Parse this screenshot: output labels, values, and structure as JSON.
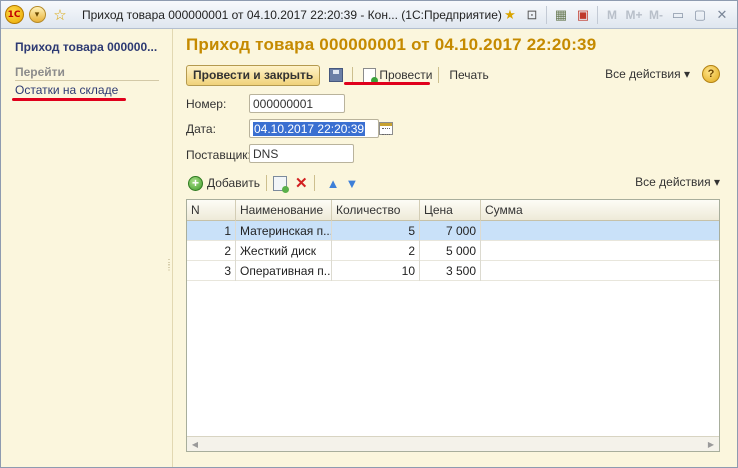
{
  "window": {
    "title": "Приход товара 000000001 от 04.10.2017 22:20:39 - Кон...  (1С:Предприятие)"
  },
  "titlebar_icons": {
    "logo": "1c",
    "menu": "chevron-down-icon",
    "favorite": "star-icon",
    "right": [
      "favorite-add-icon",
      "history-icon",
      "calculator-icon",
      "calendar-icon"
    ],
    "memory": [
      "M",
      "M+",
      "M-"
    ],
    "window_buttons": [
      "minimize-icon",
      "maximize-icon",
      "close-icon"
    ]
  },
  "sidebar": {
    "title": "Приход товара 000000...",
    "section": "Перейти",
    "items": [
      {
        "label": "Остатки на складе"
      }
    ]
  },
  "form": {
    "title": "Приход товара 000000001 от 04.10.2017 22:20:39",
    "toolbar": {
      "post_and_close": "Провести и закрыть",
      "post": "Провести",
      "print": "Печать",
      "all_actions": "Все действия",
      "help": "?"
    },
    "fields": {
      "number_label": "Номер:",
      "number_value": "000000001",
      "date_label": "Дата:",
      "date_value": "04.10.2017 22:20:39",
      "supplier_label": "Поставщик:",
      "supplier_value": "DNS"
    },
    "table_toolbar": {
      "add": "Добавить",
      "all_actions": "Все действия"
    },
    "table": {
      "columns": [
        "N",
        "Наименование",
        "Количество",
        "Цена",
        "Сумма"
      ],
      "rows": [
        {
          "n": "1",
          "name": "Материнская п...",
          "qty": "5",
          "price": "7 000",
          "sum": "",
          "selected": true
        },
        {
          "n": "2",
          "name": "Жесткий диск",
          "qty": "2",
          "price": "5 000",
          "sum": "",
          "selected": false
        },
        {
          "n": "3",
          "name": "Оперативная п...",
          "qty": "10",
          "price": "3 500",
          "sum": "",
          "selected": false
        }
      ]
    }
  },
  "colors": {
    "form_title": "#c58a00",
    "background": "#fbf6dd",
    "selection": "#c9e1f9",
    "annotation_underline": "#e0001b"
  }
}
